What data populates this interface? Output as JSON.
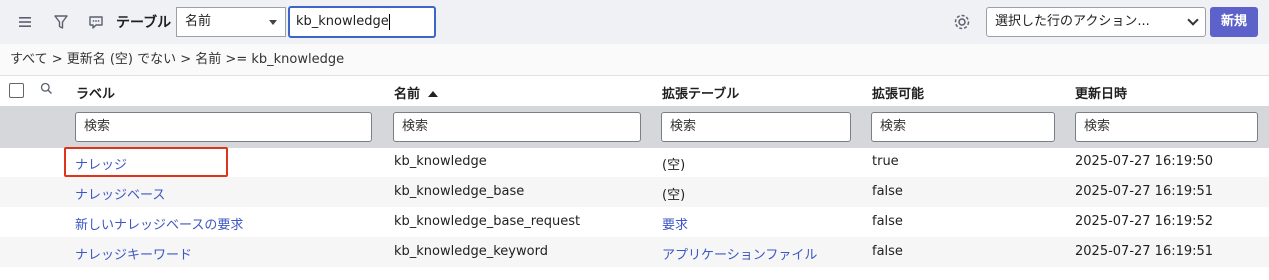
{
  "toolbar": {
    "title": "テーブル",
    "field_select": "名前",
    "search_value": "kb_knowledge",
    "actions_select": "選択した行のアクション...",
    "new_button": "新規"
  },
  "breadcrumb": {
    "text": "すべて  > 更新名 (空) でない > 名前 >= kb_knowledge"
  },
  "table": {
    "headers": {
      "label": "ラベル",
      "name": "名前",
      "extends": "拡張テーブル",
      "extensible": "拡張可能",
      "updated": "更新日時"
    },
    "filter_placeholder": "検索",
    "rows": [
      {
        "label": "ナレッジ",
        "name": "kb_knowledge",
        "extends": "(空)",
        "extends_link": false,
        "extensible": "true",
        "updated": "2025-07-27 16:19:50"
      },
      {
        "label": "ナレッジベース",
        "name": "kb_knowledge_base",
        "extends": "(空)",
        "extends_link": false,
        "extensible": "false",
        "updated": "2025-07-27 16:19:51"
      },
      {
        "label": "新しいナレッジベースの要求",
        "name": "kb_knowledge_base_request",
        "extends": "要求",
        "extends_link": true,
        "extensible": "false",
        "updated": "2025-07-27 16:19:52"
      },
      {
        "label": "ナレッジキーワード",
        "name": "kb_knowledge_keyword",
        "extends": "アプリケーションファイル",
        "extends_link": true,
        "extensible": "false",
        "updated": "2025-07-27 16:19:51"
      }
    ]
  },
  "colors": {
    "toolbar_bg": "#f0f1f4",
    "accent": "#5c62c9",
    "link": "#3d57c4",
    "highlight": "#e0341a"
  }
}
